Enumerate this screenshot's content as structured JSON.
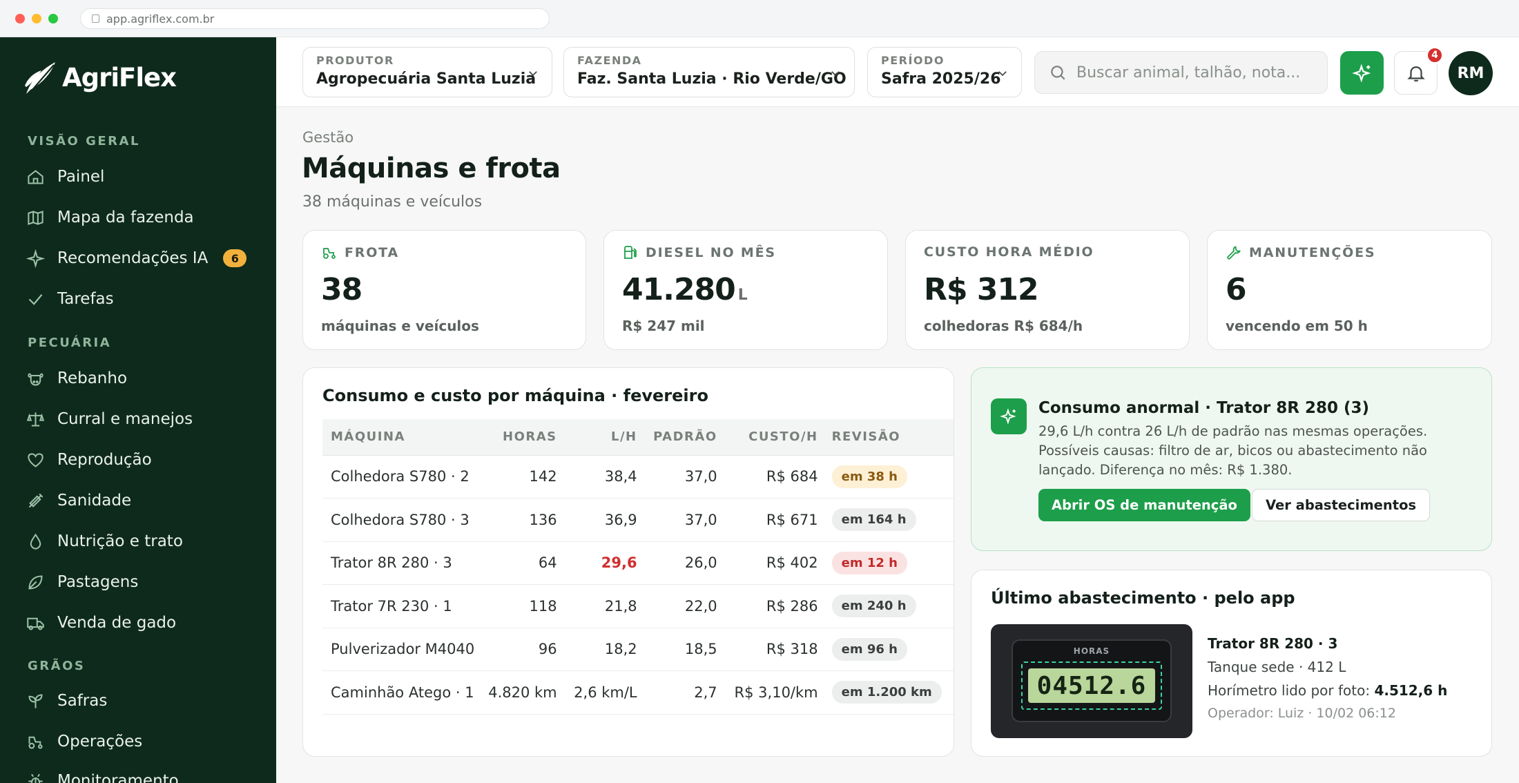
{
  "browser": {
    "url": "app.agriflex.com.br"
  },
  "brand": {
    "name": "AgriFlex",
    "accent": "#1d9e4a",
    "sidebar_bg": "#0e2a1c"
  },
  "sidebar": {
    "sections": [
      {
        "title": "VISÃO GERAL"
      },
      {
        "title": "PECUÁRIA"
      },
      {
        "title": "GRÃOS"
      }
    ],
    "items": [
      {
        "label": "Painel",
        "icon": "home-icon"
      },
      {
        "label": "Mapa da fazenda",
        "icon": "map-icon"
      },
      {
        "label": "Recomendações IA",
        "icon": "sparkle-icon",
        "badge": "6"
      },
      {
        "label": "Tarefas",
        "icon": "check-icon"
      },
      {
        "label": "Rebanho",
        "icon": "cow-icon"
      },
      {
        "label": "Curral e manejos",
        "icon": "scale-icon"
      },
      {
        "label": "Reprodução",
        "icon": "heart-icon"
      },
      {
        "label": "Sanidade",
        "icon": "syringe-icon"
      },
      {
        "label": "Nutrição e trato",
        "icon": "drop-icon"
      },
      {
        "label": "Pastagens",
        "icon": "leaf-icon"
      },
      {
        "label": "Venda de gado",
        "icon": "truck-icon"
      },
      {
        "label": "Safras",
        "icon": "sprout-icon"
      },
      {
        "label": "Operações",
        "icon": "tractor-icon"
      },
      {
        "label": "Monitoramento",
        "icon": "bug-icon"
      }
    ]
  },
  "topbar": {
    "producer": {
      "label": "PRODUTOR",
      "value": "Agropecuária Santa Luzia"
    },
    "farm": {
      "label": "FAZENDA",
      "value": "Faz. Santa Luzia · Rio Verde/GO"
    },
    "period": {
      "label": "PERÍODO",
      "value": "Safra 2025/26"
    },
    "search": {
      "placeholder": "Buscar animal, talhão, nota..."
    },
    "notifications": "4",
    "avatar": "RM"
  },
  "page": {
    "breadcrumb": "Gestão",
    "title": "Máquinas e frota",
    "subtitle": "38 máquinas e veículos"
  },
  "kpis": [
    {
      "label": "FROTA",
      "value": "38",
      "unit": "",
      "sub": "máquinas e veículos",
      "icon": "tractor-icon"
    },
    {
      "label": "DIESEL NO MÊS",
      "value": "41.280",
      "unit": "L",
      "sub": "R$ 247 mil",
      "icon": "fuel-pump-icon"
    },
    {
      "label": "CUSTO HORA MÉDIO",
      "value": "R$ 312",
      "unit": "",
      "sub": "colhedoras R$ 684/h",
      "icon": ""
    },
    {
      "label": "MANUTENÇÕES",
      "value": "6",
      "unit": "",
      "sub": "vencendo em 50 h",
      "icon": "wrench-icon"
    }
  ],
  "table": {
    "title": "Consumo e custo por máquina · fevereiro",
    "columns": [
      "MÁQUINA",
      "HORAS",
      "L/H",
      "PADRÃO",
      "CUSTO/H",
      "REVISÃO"
    ],
    "rows": [
      {
        "machine": "Colhedora S780 · 2",
        "hours": "142",
        "lph": "38,4",
        "standard": "37,0",
        "cost": "R$ 684",
        "review": "em 38 h",
        "status": "warn"
      },
      {
        "machine": "Colhedora S780 · 3",
        "hours": "136",
        "lph": "36,9",
        "standard": "37,0",
        "cost": "R$ 671",
        "review": "em 164 h",
        "status": "normal"
      },
      {
        "machine": "Trator 8R 280 · 3",
        "hours": "64",
        "lph": "29,6",
        "standard": "26,0",
        "cost": "R$ 402",
        "review": "em 12 h",
        "status": "danger"
      },
      {
        "machine": "Trator 7R 230 · 1",
        "hours": "118",
        "lph": "21,8",
        "standard": "22,0",
        "cost": "R$ 286",
        "review": "em 240 h",
        "status": "normal"
      },
      {
        "machine": "Pulverizador M4040",
        "hours": "96",
        "lph": "18,2",
        "standard": "18,5",
        "cost": "R$ 318",
        "review": "em 96 h",
        "status": "normal"
      },
      {
        "machine": "Caminhão Atego · 1",
        "hours": "4.820 km",
        "lph": "2,6 km/L",
        "standard": "2,7",
        "cost": "R$ 3,10/km",
        "review": "em 1.200 km",
        "status": "normal"
      }
    ]
  },
  "alert": {
    "title": "Consumo anormal · Trator 8R 280 (3)",
    "body": "29,6 L/h contra 26 L/h de padrão nas mesmas operações. Possíveis causas: filtro de ar, bicos ou abastecimento não lançado. Diferença no mês: R$ 1.380.",
    "primary_label": "Abrir OS de manutenção",
    "secondary_label": "Ver abastecimentos"
  },
  "fuel": {
    "title": "Último abastecimento · pelo app",
    "meter_label": "HORAS",
    "meter_value": "04512.6",
    "machine": "Trator 8R 280 · 3",
    "tank": "Tanque sede · 412 L",
    "hourmeter_label": "Horímetro lido por foto:",
    "hourmeter_value": "4.512,6 h",
    "operator": "Operador: Luiz · 10/02 06:12"
  }
}
